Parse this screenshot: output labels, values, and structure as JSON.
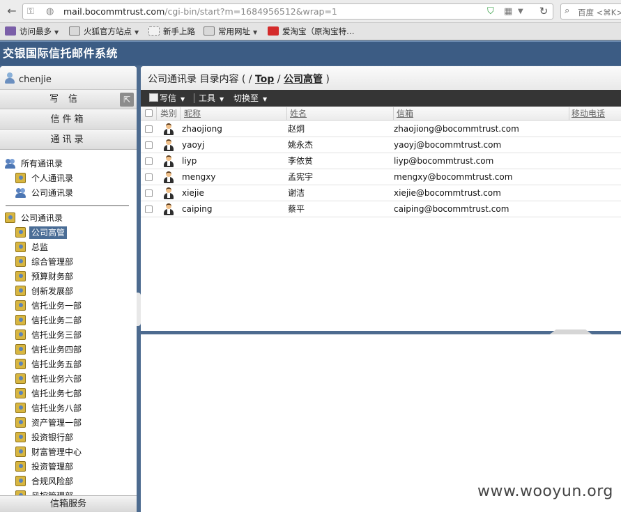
{
  "browser": {
    "url_host": "mail.bocommtrust.com",
    "url_path": "/cgi-bin/start?m=1684956512&wrap=1",
    "search_placeholder": "百度 <⌘K>"
  },
  "bookmarks": [
    {
      "label": "访问最多",
      "icon": "star-folder-icon",
      "dropdown": true
    },
    {
      "label": "火狐官方站点",
      "icon": "folder-icon",
      "dropdown": true
    },
    {
      "label": "新手上路",
      "icon": "dashed-page-icon",
      "dropdown": false
    },
    {
      "label": "常用网址",
      "icon": "folder-icon",
      "dropdown": true
    },
    {
      "label": "爱淘宝（原淘宝特…",
      "icon": "taobao-icon",
      "dropdown": false
    }
  ],
  "app": {
    "title": "交银国际信托邮件系统"
  },
  "sidebar": {
    "username": "chenjie",
    "compose": "写信",
    "inbox": "信件箱",
    "contacts": "通讯录",
    "address_books": [
      {
        "label": "所有通讯录",
        "icon": "people-icon"
      },
      {
        "label": "个人通讯录",
        "icon": "address-book-icon"
      },
      {
        "label": "公司通讯录",
        "icon": "people-icon"
      }
    ],
    "company_root": "公司通讯录",
    "departments": [
      "公司高管",
      "总监",
      "综合管理部",
      "预算财务部",
      "创新发展部",
      "信托业务一部",
      "信托业务二部",
      "信托业务三部",
      "信托业务四部",
      "信托业务五部",
      "信托业务六部",
      "信托业务七部",
      "信托业务八部",
      "资产管理一部",
      "投资银行部",
      "财富管理中心",
      "投资管理部",
      "合规风险部",
      "风控管理部"
    ],
    "selected_department": "公司高管",
    "mailbox_service": "信箱服务"
  },
  "main": {
    "breadcrumb": {
      "prefix": "公司通讯录 目录内容 ( / ",
      "top": "Top",
      "sep": " / ",
      "current": "公司高管",
      "suffix": " )"
    },
    "toolbar": {
      "compose": "写信",
      "tools": "工具",
      "switch_to": "切换至"
    },
    "columns": {
      "type": "类别",
      "nickname": "昵称",
      "name": "姓名",
      "email": "信箱",
      "mobile": "移动电话"
    },
    "rows": [
      {
        "nickname": "zhaojiong",
        "name": "赵炯",
        "email": "zhaojiong@bocommtrust.com",
        "mobile": ""
      },
      {
        "nickname": "yaoyj",
        "name": "姚永杰",
        "email": "yaoyj@bocommtrust.com",
        "mobile": ""
      },
      {
        "nickname": "liyp",
        "name": "李依贫",
        "email": "liyp@bocommtrust.com",
        "mobile": ""
      },
      {
        "nickname": "mengxy",
        "name": "孟宪宇",
        "email": "mengxy@bocommtrust.com",
        "mobile": ""
      },
      {
        "nickname": "xiejie",
        "name": "谢洁",
        "email": "xiejie@bocommtrust.com",
        "mobile": ""
      },
      {
        "nickname": "caiping",
        "name": "蔡平",
        "email": "caiping@bocommtrust.com",
        "mobile": ""
      }
    ]
  },
  "watermark": "www.wooyun.org"
}
